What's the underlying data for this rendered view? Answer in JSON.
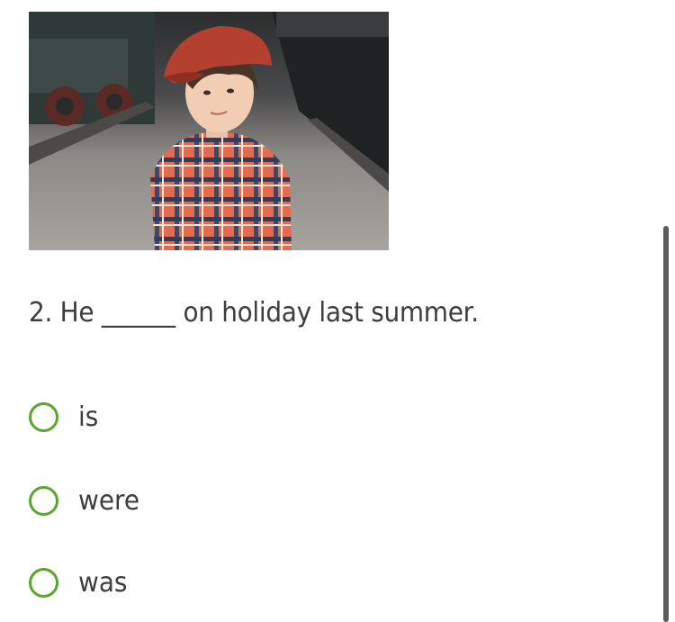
{
  "question": {
    "text": "2. He ______ on holiday last summer."
  },
  "options": [
    {
      "label": "is",
      "selected": false
    },
    {
      "label": "were",
      "selected": false
    },
    {
      "label": "was",
      "selected": false
    }
  ],
  "colors": {
    "radio_border": "#5aa52f",
    "text": "#3d3d3d",
    "scrollbar": "#5b5b5b"
  },
  "icons": [
    "radio-button-icon"
  ]
}
